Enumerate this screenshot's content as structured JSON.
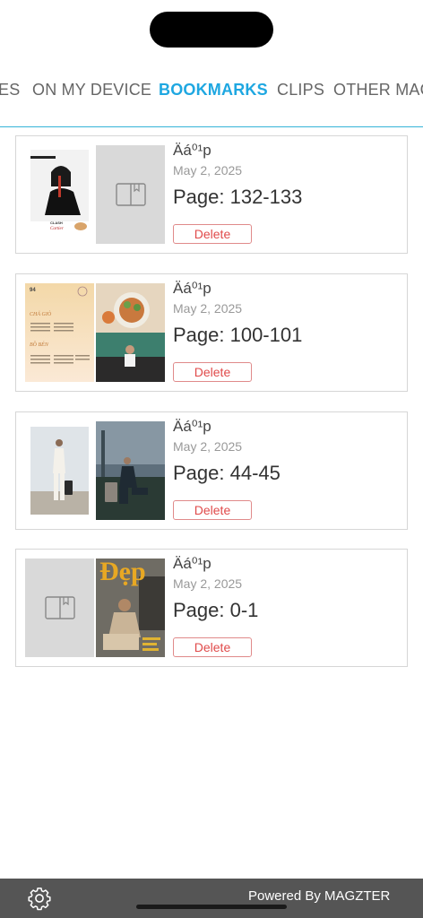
{
  "tabs": [
    {
      "label": "ES",
      "active": false
    },
    {
      "label": "ON MY DEVICE",
      "active": false
    },
    {
      "label": "BOOKMARKS",
      "active": true
    },
    {
      "label": "CLIPS",
      "active": false
    },
    {
      "label": "OTHER MAG",
      "active": false
    }
  ],
  "bookmarks": [
    {
      "title": "Äá⁰¹p",
      "date": "May 2, 2025",
      "page": "Page: 132-133",
      "delete_label": "Delete"
    },
    {
      "title": "Äá⁰¹p",
      "date": "May 2, 2025",
      "page": "Page: 100-101",
      "delete_label": "Delete"
    },
    {
      "title": "Äá⁰¹p",
      "date": "May 2, 2025",
      "page": "Page: 44-45",
      "delete_label": "Delete"
    },
    {
      "title": "Äá⁰¹p",
      "date": "May 2, 2025",
      "page": "Page: 0-1",
      "delete_label": "Delete"
    }
  ],
  "thumb_text": {
    "card1_left": "CLASH",
    "card1_brand": "Cartier",
    "card2_num": "94",
    "card2_heading1": "CHẢ GIÒ",
    "card2_heading2": "BỒ BÉN",
    "card4_logo": "Đẹp"
  },
  "footer": {
    "settings_icon": "gear-icon",
    "powered_label": "Powered By MAGZTER"
  },
  "colors": {
    "accent": "#1ea7e1",
    "delete": "#e04a4a",
    "footer_bg": "#555555"
  }
}
